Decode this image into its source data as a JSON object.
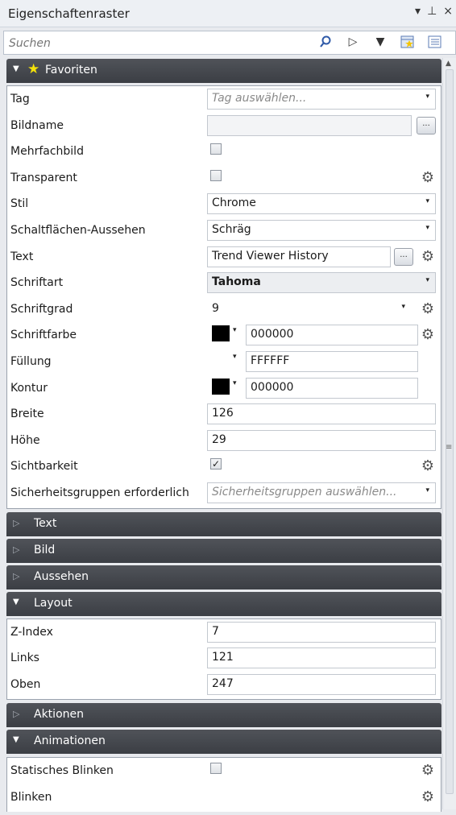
{
  "panel": {
    "title": "Eigenschaftenraster",
    "pin_glyph": "↓ ↧ ×"
  },
  "search": {
    "placeholder": "Suchen"
  },
  "categories": {
    "favoriten": "Favoriten",
    "text": "Text",
    "bild": "Bild",
    "aussehen": "Aussehen",
    "layout": "Layout",
    "aktionen": "Aktionen",
    "animationen": "Animationen"
  },
  "favoriten": {
    "tag": {
      "label": "Tag",
      "placeholder": "Tag auswählen..."
    },
    "bildname": {
      "label": "Bildname",
      "value": ""
    },
    "mehrfachbild": {
      "label": "Mehrfachbild",
      "checked": false
    },
    "transparent": {
      "label": "Transparent",
      "checked": false
    },
    "stil": {
      "label": "Stil",
      "value": "Chrome"
    },
    "schaltflaechen": {
      "label": "Schaltflächen-Aussehen",
      "value": "Schräg"
    },
    "text": {
      "label": "Text",
      "value": "Trend Viewer History"
    },
    "schriftart": {
      "label": "Schriftart",
      "value": "Tahoma"
    },
    "schriftgrad": {
      "label": "Schriftgrad",
      "value": "9"
    },
    "schriftfarbe": {
      "label": "Schriftfarbe",
      "value": "000000",
      "color": "#000000"
    },
    "fuellung": {
      "label": "Füllung",
      "value": "FFFFFF",
      "color": "#FFFFFF"
    },
    "kontur": {
      "label": "Kontur",
      "value": "000000",
      "color": "#000000"
    },
    "breite": {
      "label": "Breite",
      "value": "126"
    },
    "hoehe": {
      "label": "Höhe",
      "value": "29"
    },
    "sichtbarkeit": {
      "label": "Sichtbarkeit",
      "checked": true
    },
    "sicherheit": {
      "label": "Sicherheitsgruppen erforderlich",
      "placeholder": "Sicherheitsgruppen auswählen..."
    }
  },
  "layout": {
    "zindex": {
      "label": "Z-Index",
      "value": "7"
    },
    "links": {
      "label": "Links",
      "value": "121"
    },
    "oben": {
      "label": "Oben",
      "value": "247"
    }
  },
  "animationen": {
    "statisches_blinken": {
      "label": "Statisches Blinken",
      "checked": false
    },
    "blinken": {
      "label": "Blinken"
    }
  },
  "glyphs": {
    "checkmark": "✓",
    "ellipsis": "...",
    "dropdown": "▾",
    "expanded": "▼",
    "collapsed": "▷",
    "gear": "⚙",
    "star": "★"
  }
}
